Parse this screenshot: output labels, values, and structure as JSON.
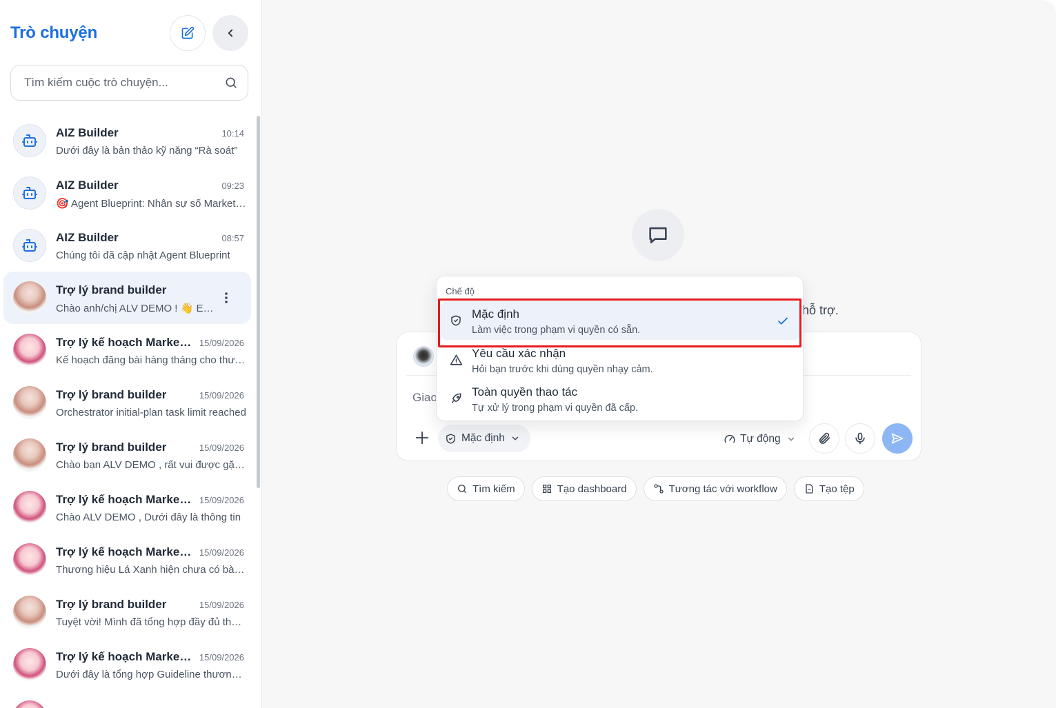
{
  "sidebar": {
    "title": "Trò chuyện",
    "search_placeholder": "Tìm kiếm cuộc trò chuyện...",
    "conversations": [
      {
        "name": "AIZ Builder",
        "time": "10:14",
        "preview": "Dưới đây là bản thảo kỹ năng “Rà soát”",
        "avatar": "bot-icon"
      },
      {
        "name": "AIZ Builder",
        "time": "09:23",
        "preview": "🎯 Agent Blueprint: Nhân sự số Marketing",
        "avatar": "bot-icon"
      },
      {
        "name": "AIZ Builder",
        "time": "08:57",
        "preview": "Chúng tôi đã cập nhật Agent Blueprint",
        "avatar": "bot-icon"
      },
      {
        "name": "Trợ lý brand builder",
        "time": "",
        "preview": "Chào anh/chị ALV DEMO ! 👋 Em là",
        "avatar": "brand-avatar"
      },
      {
        "name": "Trợ lý kế hoạch Marketing",
        "time": "15/09/2026",
        "preview": "Kế hoạch đăng bài hàng tháng cho thương hiệu",
        "avatar": "marketing-avatar"
      },
      {
        "name": "Trợ lý brand builder",
        "time": "15/09/2026",
        "preview": "Orchestrator initial-plan task limit reached",
        "avatar": "brand-avatar"
      },
      {
        "name": "Trợ lý brand builder",
        "time": "15/09/2026",
        "preview": "Chào bạn ALV DEMO , rất vui được gặp bạn",
        "avatar": "brand-avatar"
      },
      {
        "name": "Trợ lý kế hoạch Marketing",
        "time": "15/09/2026",
        "preview": "Chào ALV DEMO , Dưới đây là thông tin",
        "avatar": "marketing-avatar"
      },
      {
        "name": "Trợ lý kế hoạch Marketing",
        "time": "15/09/2026",
        "preview": "Thương hiệu Lá Xanh hiện chưa có bài viết",
        "avatar": "marketing-avatar"
      },
      {
        "name": "Trợ lý brand builder",
        "time": "15/09/2026",
        "preview": "Tuyệt vời! Mình đã tổng hợp đầy đủ thông tin",
        "avatar": "brand-avatar"
      },
      {
        "name": "Trợ lý kế hoạch Marketing",
        "time": "15/09/2026",
        "preview": "Dưới đây là tổng hợp Guideline thương hiệu",
        "avatar": "marketing-avatar"
      }
    ]
  },
  "main": {
    "partial_text": "hỗ trợ.",
    "composer": {
      "input_text": "Giao",
      "mode_label": "Mặc định",
      "model_label": "Tự động"
    },
    "chips": [
      {
        "label": "Tìm kiếm",
        "icon": "search-icon"
      },
      {
        "label": "Tạo dashboard",
        "icon": "grid-icon"
      },
      {
        "label": "Tương tác với workflow",
        "icon": "workflow-icon"
      },
      {
        "label": "Tạo tệp",
        "icon": "file-icon"
      }
    ]
  },
  "dropdown": {
    "title": "Chế độ",
    "items": [
      {
        "name": "Mặc định",
        "desc": "Làm việc trong phạm vi quyền có sẵn.",
        "icon": "shield-icon",
        "selected": true
      },
      {
        "name": "Yêu cầu xác nhận",
        "desc": "Hỏi bạn trước khi dùng quyền nhạy cảm.",
        "icon": "warning-icon",
        "selected": false
      },
      {
        "name": "Toàn quyền thao tác",
        "desc": "Tự xử lý trong phạm vi quyền đã cấp.",
        "icon": "rocket-icon",
        "selected": false
      }
    ]
  },
  "colors": {
    "accent": "#1d6fe0",
    "send": "#8db6f5",
    "highlight": "#e5191c",
    "selected_bg": "#edf1fa"
  }
}
